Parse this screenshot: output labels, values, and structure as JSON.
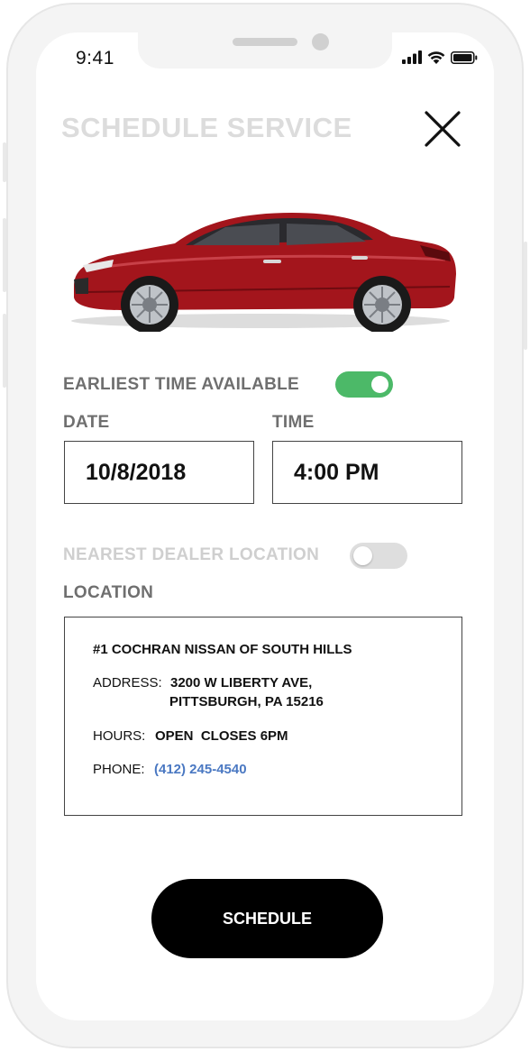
{
  "status_bar": {
    "time": "9:41",
    "icons": [
      "cellular-signal-icon",
      "wifi-icon",
      "battery-icon"
    ]
  },
  "header": {
    "title": "SCHEDULE SERVICE",
    "close_icon": "close-icon"
  },
  "vehicle": {
    "image": "red-sedan-car",
    "color": "#a3151c"
  },
  "earliest_time": {
    "label": "EARLIEST TIME AVAILABLE",
    "enabled": true
  },
  "date": {
    "label": "DATE",
    "value": "10/8/2018"
  },
  "time": {
    "label": "TIME",
    "value": "4:00 PM"
  },
  "nearest_dealer": {
    "label": "NEAREST DEALER LOCATION",
    "enabled": false
  },
  "location": {
    "label": "LOCATION",
    "dealer_name": "#1 COCHRAN NISSAN OF SOUTH HILLS",
    "address_label": "ADDRESS:",
    "address_line1": "3200 W LIBERTY AVE,",
    "address_line2": "PITTSBURGH, PA 15216",
    "hours_label": "HOURS:",
    "hours_value": "OPEN  CLOSES 6PM",
    "phone_label": "PHONE:",
    "phone_value": "(412) 245-4540"
  },
  "actions": {
    "schedule_label": "SCHEDULE"
  },
  "colors": {
    "toggle_on": "#4cb968",
    "toggle_off": "#dedede",
    "link": "#4a78c2",
    "button_bg": "#000000",
    "title_muted": "#dcdcdc"
  }
}
